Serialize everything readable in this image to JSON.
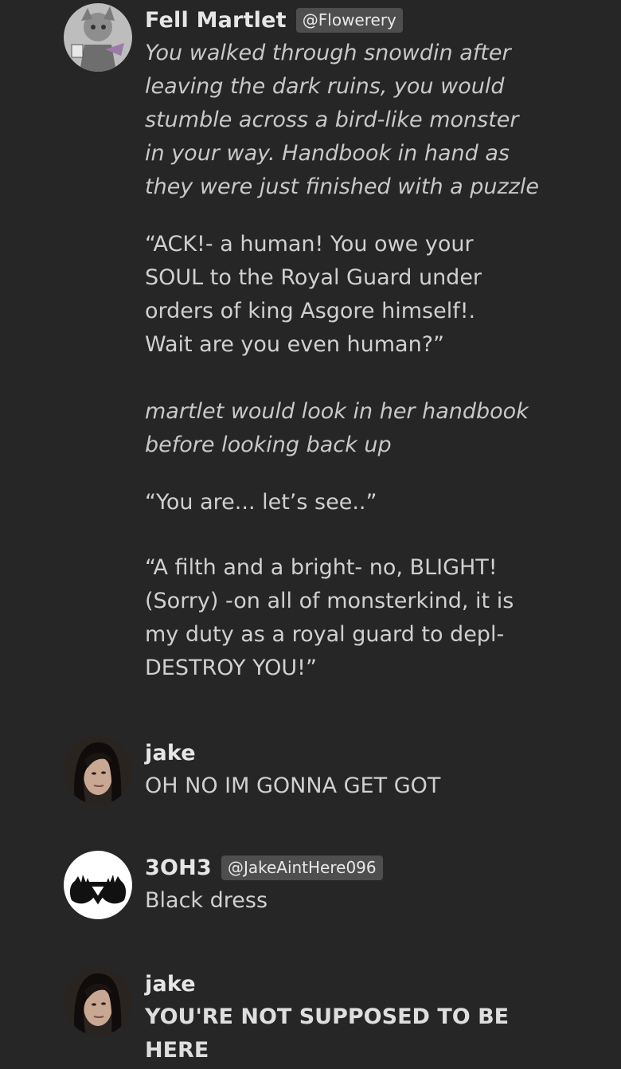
{
  "messages": [
    {
      "name": "Fell Martlet",
      "handle": "@Flowerery",
      "avatar": "martlet-character-avatar",
      "paragraphs": [
        {
          "style": "italic",
          "lines": [
            "You walked through snowdin after",
            "leaving the dark ruins, you would",
            "stumble across a bird-like monster",
            "in your way. Handbook in hand as",
            "they were just finished with a puzzle"
          ]
        },
        {
          "style": "normal",
          "lines": [
            "“ACK!- a human! You owe your",
            "SOUL to the Royal Guard under",
            "orders of king Asgore himself!.",
            "Wait are you even human?”"
          ]
        },
        {
          "style": "italic",
          "lines": [
            "martlet would look in her handbook",
            "before looking back up"
          ]
        },
        {
          "style": "normal",
          "lines": [
            "“You are... let’s see..”"
          ]
        },
        {
          "style": "normal",
          "lines": [
            "“A filth and a bright- no, BLIGHT!",
            "(Sorry) -on all of monsterkind, it is",
            "my duty as a royal guard to depl-",
            "DESTROY YOU!”"
          ]
        }
      ]
    },
    {
      "name": "jake",
      "handle": "",
      "avatar": "jake-portrait-avatar",
      "paragraphs": [
        {
          "style": "normal",
          "lines": [
            "OH NO IM GONNA GET GOT"
          ]
        }
      ]
    },
    {
      "name": "3OH3",
      "handle": "@JakeAintHere096",
      "avatar": "3oh3-hands-logo-avatar",
      "paragraphs": [
        {
          "style": "normal",
          "lines": [
            "Black dress"
          ]
        }
      ]
    },
    {
      "name": "jake",
      "handle": "",
      "avatar": "jake-portrait-avatar",
      "paragraphs": [
        {
          "style": "bold",
          "lines": [
            "YOU'RE NOT SUPPOSED TO BE",
            "HERE"
          ]
        }
      ]
    }
  ]
}
